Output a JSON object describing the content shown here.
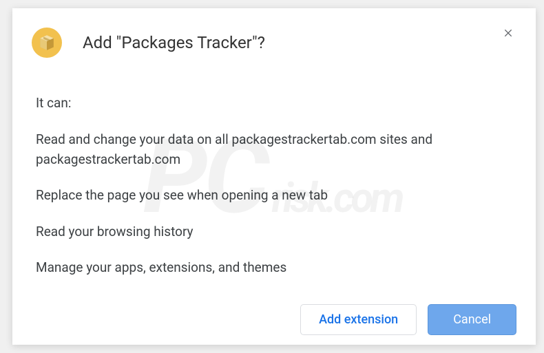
{
  "dialog": {
    "title": "Add \"Packages Tracker\"?",
    "intro": "It can:",
    "permissions": [
      "Read and change your data on all packagestrackertab.com sites and packagestrackertab.com",
      "Replace the page you see when opening a new tab",
      "Read your browsing history",
      "Manage your apps, extensions, and themes"
    ],
    "buttons": {
      "add": "Add extension",
      "cancel": "Cancel"
    }
  },
  "watermark": {
    "prefix": "PC",
    "suffix": "risk.com"
  }
}
